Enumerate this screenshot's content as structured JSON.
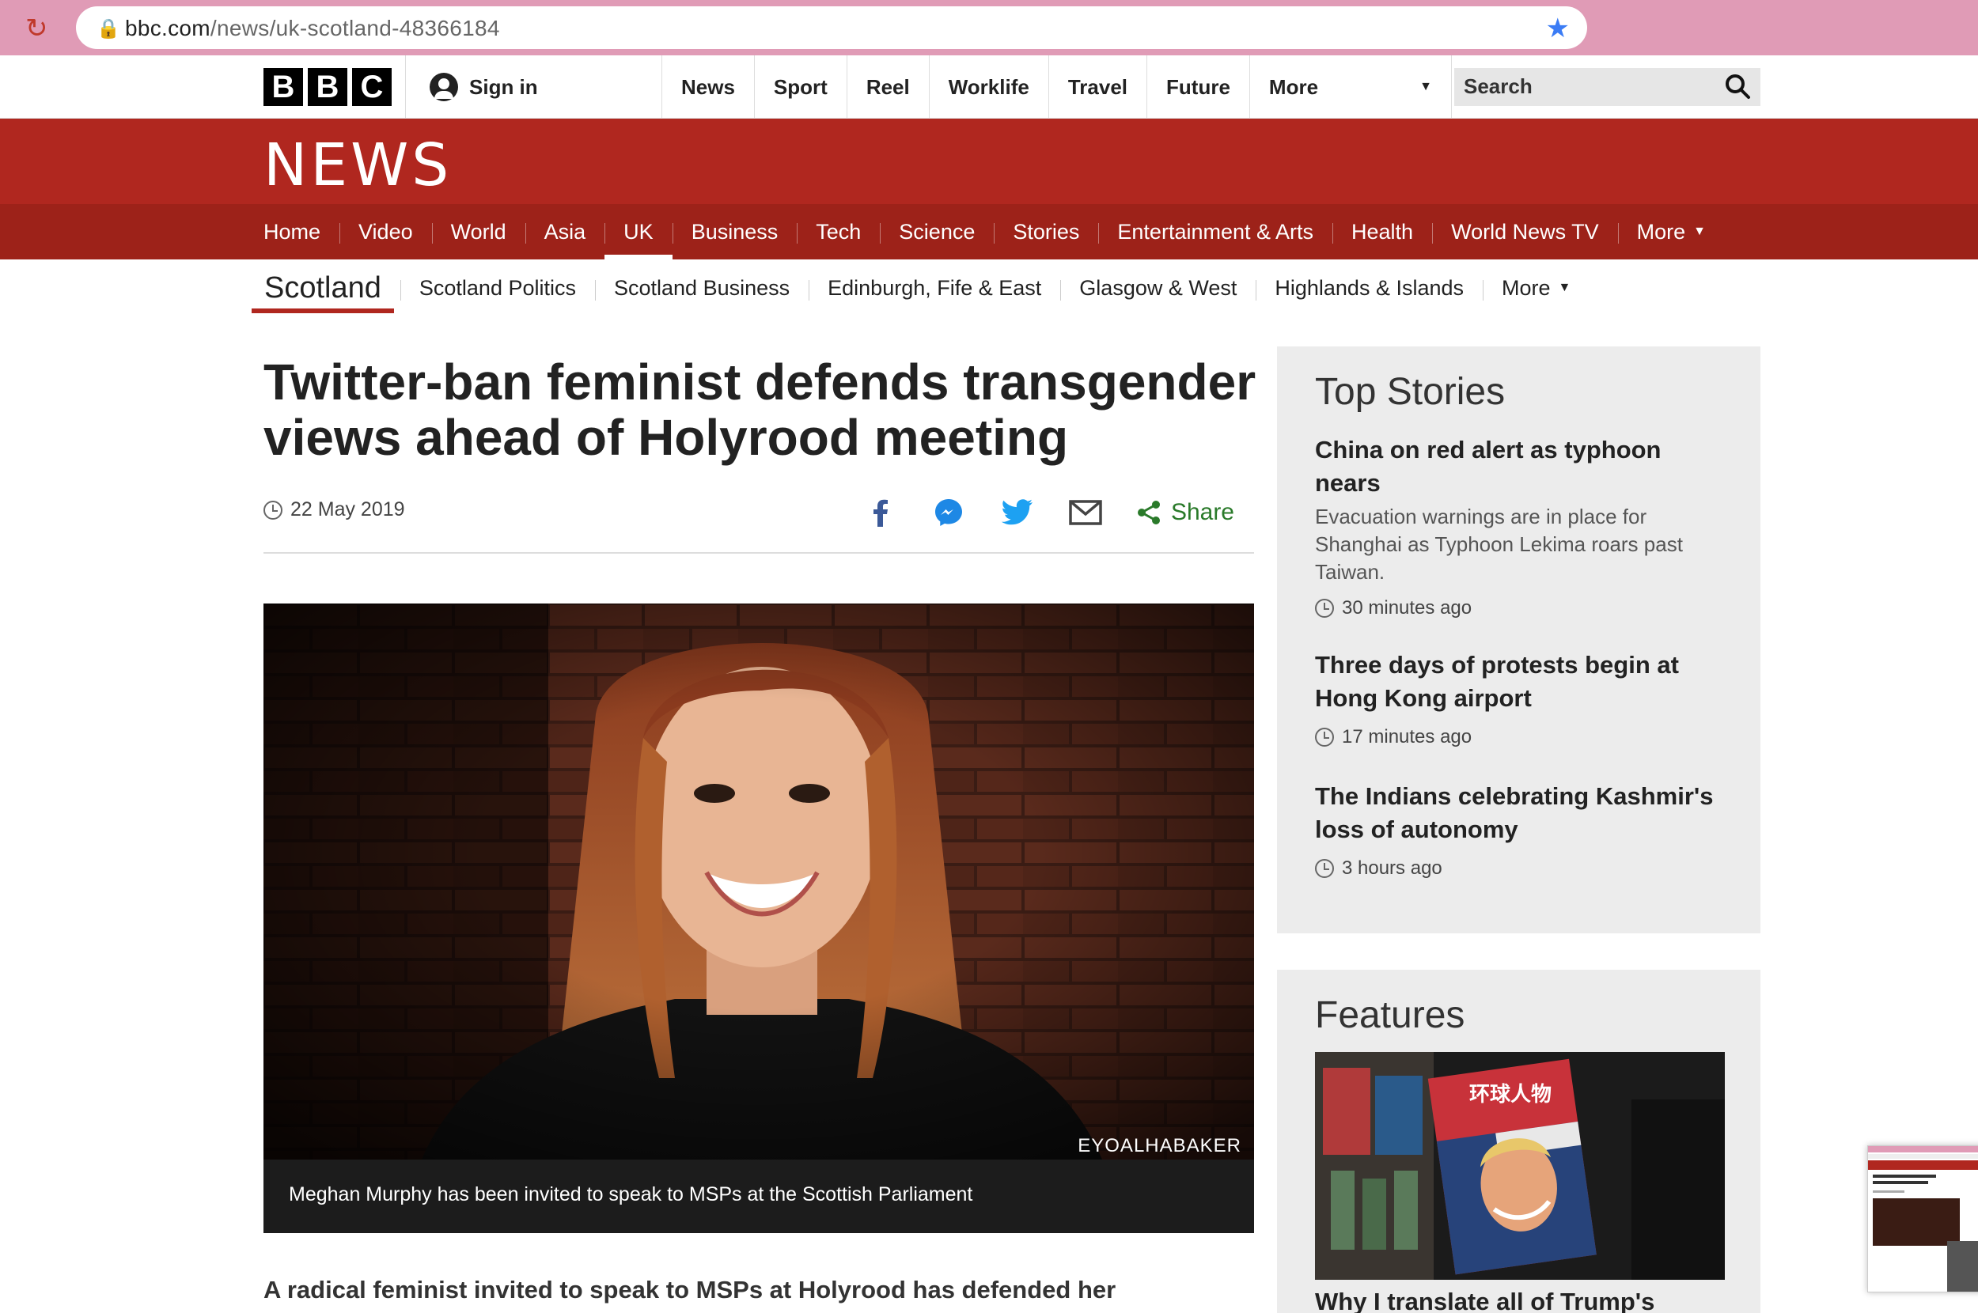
{
  "browser": {
    "url_host": "bbc.com",
    "url_path": "/news/uk-scotland-48366184"
  },
  "masthead": {
    "logo_letters": [
      "B",
      "B",
      "C"
    ],
    "signin_label": "Sign in",
    "nav": [
      "News",
      "Sport",
      "Reel",
      "Worklife",
      "Travel",
      "Future"
    ],
    "more_label": "More",
    "search_placeholder": "Search"
  },
  "news": {
    "logo": "NEWS",
    "nav": [
      "Home",
      "Video",
      "World",
      "Asia",
      "UK",
      "Business",
      "Tech",
      "Science",
      "Stories",
      "Entertainment & Arts",
      "Health",
      "World News TV"
    ],
    "nav_more": "More",
    "active_item": "UK"
  },
  "subnav": {
    "section": "Scotland",
    "items": [
      "Scotland Politics",
      "Scotland Business",
      "Edinburgh, Fife & East",
      "Glasgow & West",
      "Highlands & Islands"
    ],
    "more_label": "More"
  },
  "article": {
    "headline": "Twitter-ban feminist defends transgender views ahead of Holyrood meeting",
    "date": "22 May 2019",
    "share_label": "Share",
    "photo_credit": "EYOALHABAKER",
    "caption": "Meghan Murphy has been invited to speak to MSPs at the Scottish Parliament",
    "intro": "A radical feminist invited to speak to MSPs at Holyrood has defended her"
  },
  "top_stories": {
    "title": "Top Stories",
    "stories": [
      {
        "title": "China on red alert as typhoon nears",
        "summary": "Evacuation warnings are in place for Shanghai as Typhoon Lekima roars past Taiwan.",
        "time": "30 minutes ago"
      },
      {
        "title": "Three days of protests begin at Hong Kong airport",
        "summary": "",
        "time": "17 minutes ago"
      },
      {
        "title": "The Indians celebrating Kashmir's loss of autonomy",
        "summary": "",
        "time": "3 hours ago"
      }
    ]
  },
  "features": {
    "title": "Features",
    "first_title": "Why I translate all of Trump's",
    "magazine_text": "环球人物"
  },
  "colors": {
    "bbc_red": "#b0271f",
    "nav_red": "#9d2219",
    "share_green": "#2a7a2a",
    "chrome_pink": "#e09bb6"
  }
}
